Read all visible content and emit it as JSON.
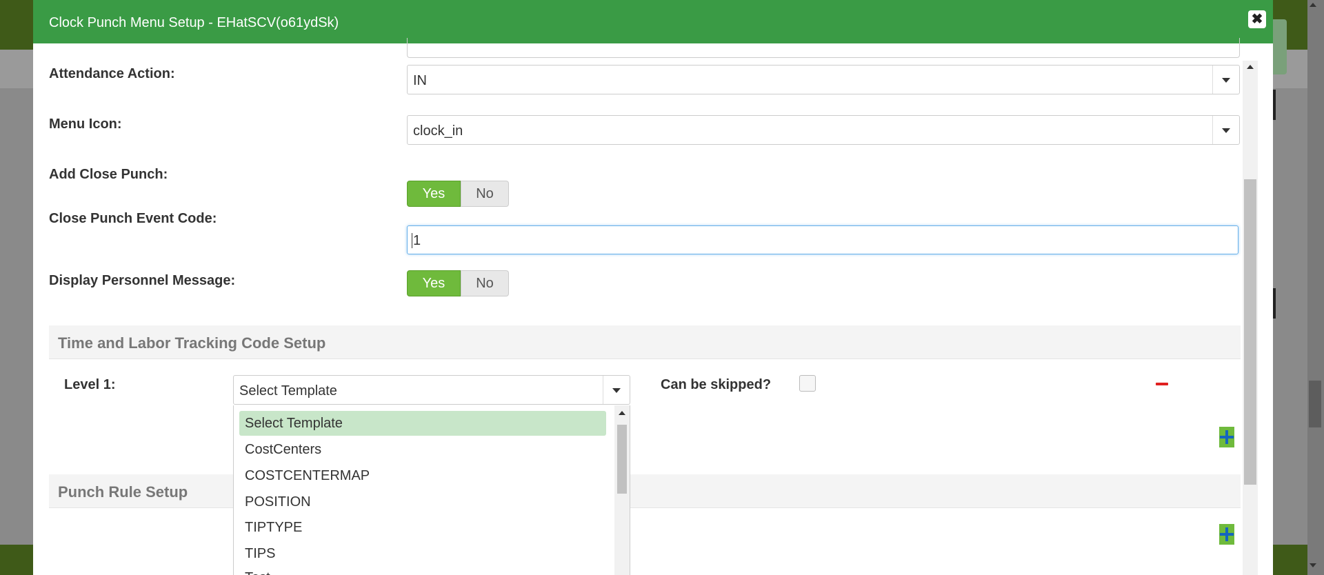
{
  "modal": {
    "title": "Clock Punch Menu Setup - EHatSCV(o61ydSk)",
    "close_icon": "✖"
  },
  "form": {
    "attendance_action": {
      "label": "Attendance Action:",
      "value": "IN"
    },
    "menu_icon": {
      "label": "Menu Icon:",
      "value": "clock_in"
    },
    "add_close_punch": {
      "label": "Add Close Punch:",
      "yes": "Yes",
      "no": "No",
      "selected": "Yes"
    },
    "close_punch_event_code": {
      "label": "Close Punch Event Code:",
      "value": "1"
    },
    "display_personnel_message": {
      "label": "Display Personnel Message:",
      "yes": "Yes",
      "no": "No",
      "selected": "Yes"
    }
  },
  "time_labor": {
    "title": "Time and Labor Tracking Code Setup",
    "level_label": "Level 1:",
    "template_value": "Select Template",
    "can_be_skipped_label": "Can be skipped?",
    "can_be_skipped_checked": false,
    "dropdown_options": [
      "Select Template",
      "CostCenters",
      "COSTCENTERMAP",
      "POSITION",
      "TIPTYPE",
      "TIPS",
      "Test"
    ],
    "dropdown_selected": "Select Template"
  },
  "punch_rule": {
    "title": "Punch Rule Setup"
  },
  "colors": {
    "header_green": "#3a9b45",
    "toggle_green": "#6fba3c",
    "selected_option": "#c8e6c9",
    "remove_red": "#e02020",
    "add_blue": "#1565c0"
  },
  "icons": {
    "close": "close-icon",
    "select_arrow": "chevron-down-icon",
    "remove": "minus-icon",
    "add": "plus-icon"
  }
}
